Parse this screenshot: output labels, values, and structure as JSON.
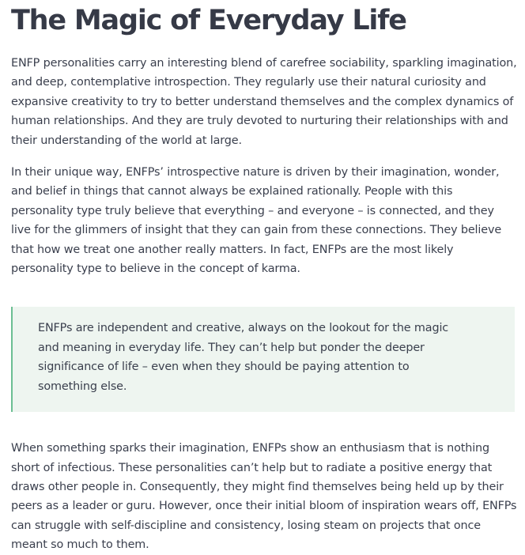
{
  "article": {
    "title": "The Magic of Everyday Life",
    "paragraph_1": "ENFP personalities carry an interesting blend of carefree sociability, sparkling imagination, and deep, contemplative introspection. They regularly use their natural curiosity and expansive creativity to try to better understand themselves and the complex dynamics of human relationships. And they are truly devoted to nurturing their relationships with and their understanding of the world at large.",
    "paragraph_2": "In their unique way, ENFPs’ introspective nature is driven by their imagination, wonder, and belief in things that cannot always be explained rationally. People with this personality type truly believe that everything – and everyone – is connected, and they live for the glimmers of insight that they can gain from these connections. They believe that how we treat one another really matters. In fact, ENFPs are the most likely personality type to believe in the concept of karma.",
    "blockquote": "ENFPs are independent and creative, always on the lookout for the magic and meaning in everyday life. They can’t help but ponder the deeper significance of life – even when they should be paying attention to something else.",
    "paragraph_3": "When something sparks their imagination, ENFPs show an enthusiasm that is nothing short of infectious. These personalities can’t help but to radiate a positive energy that draws other people in. Consequently, they might find themselves being held up by their peers as a leader or guru. However, once their initial bloom of inspiration wears off, ENFPs can struggle with self-discipline and consistency, losing steam on projects that once meant so much to them."
  },
  "colors": {
    "text": "#3a3f4d",
    "heading": "#363a47",
    "quote_background": "#eef5f0",
    "quote_border": "#6cbf93"
  }
}
